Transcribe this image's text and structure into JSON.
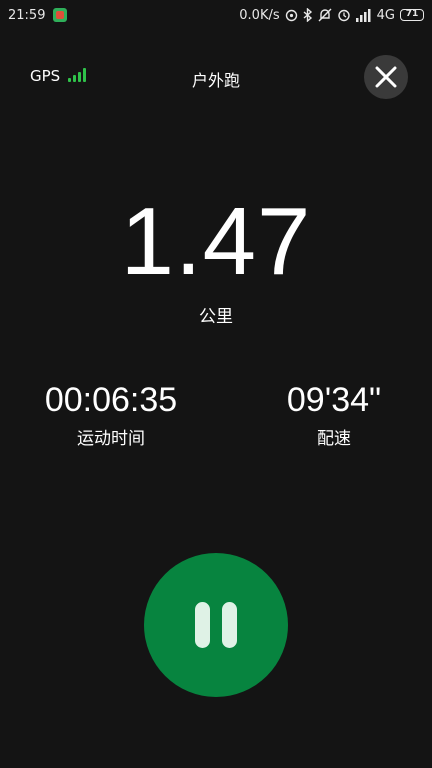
{
  "status_bar": {
    "time": "21:59",
    "network_speed": "0.0K/s",
    "network_type": "4G",
    "battery": "71",
    "icons": [
      "app-notification-icon",
      "hotspot-icon",
      "bluetooth-icon",
      "dnd-icon",
      "alarm-icon",
      "hd-signal-icon",
      "signal-icon",
      "battery-icon"
    ]
  },
  "header": {
    "gps_label": "GPS",
    "gps_signal_level": 4,
    "title": "户外跑"
  },
  "distance": {
    "value": "1.47",
    "unit": "公里"
  },
  "stats": {
    "duration": {
      "value": "00:06:35",
      "label": "运动时间"
    },
    "pace": {
      "value": "09'34\"",
      "label": "配速"
    }
  },
  "colors": {
    "background": "#141414",
    "accent_green": "#07843f",
    "gps_green": "#2fc24a",
    "close_bg": "#3a3a3a"
  }
}
